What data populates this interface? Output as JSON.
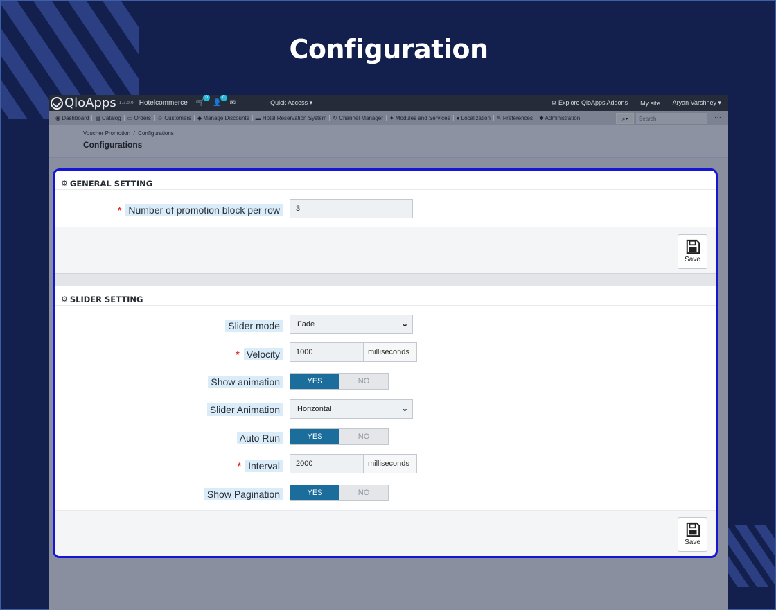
{
  "page_title": "Configuration",
  "topbar": {
    "logo_text": "QloApps",
    "version": "1.7.0.0",
    "store_name": "Hotelcommerce",
    "cart_badge": "0",
    "customer_badge": "0",
    "quick_access": "Quick Access",
    "explore_addons": "Explore QloApps Addons",
    "my_site": "My site",
    "user_name": "Aryan Varshney"
  },
  "menu": {
    "items": [
      "Dashboard",
      "Catalog",
      "Orders",
      "Customers",
      "Manage Discounts",
      "Hotel Reservation System",
      "Channel Manager",
      "Modules and Services",
      "Localization",
      "Preferences",
      "Administration"
    ],
    "search_placeholder": "Search"
  },
  "header": {
    "breadcrumb_parent": "Voucher Promotion",
    "breadcrumb_sep": "/",
    "breadcrumb_current": "Configurations",
    "title": "Configurations"
  },
  "general": {
    "title": "GENERAL SETTING",
    "promo_label": "Number of promotion block per row",
    "promo_value": "3",
    "save_label": "Save"
  },
  "slider": {
    "title": "SLIDER SETTING",
    "mode_label": "Slider mode",
    "mode_value": "Fade",
    "velocity_label": "Velocity",
    "velocity_value": "1000",
    "velocity_unit": "milliseconds",
    "show_anim_label": "Show animation",
    "anim_label": "Slider Animation",
    "anim_value": "Horizontal",
    "auto_run_label": "Auto Run",
    "interval_label": "Interval",
    "interval_value": "2000",
    "interval_unit": "milliseconds",
    "pagination_label": "Show Pagination",
    "yes": "YES",
    "no": "NO",
    "save_label": "Save"
  },
  "colors": {
    "background": "#13204e",
    "highlight_border": "#1515d6",
    "toggle_active": "#1b6d9c"
  }
}
